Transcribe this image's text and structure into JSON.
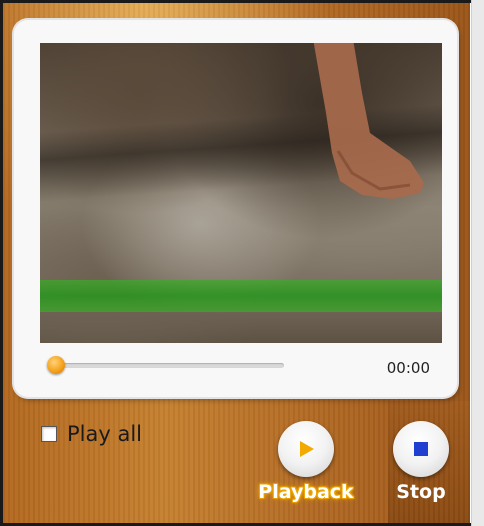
{
  "player": {
    "time_display": "00:00",
    "seek_position": 0
  },
  "options": {
    "play_all_label": "Play all",
    "play_all_checked": false
  },
  "controls": {
    "playback_label": "Playback",
    "stop_label": "Stop",
    "play_icon": "play-triangle-icon",
    "stop_icon": "stop-square-icon"
  },
  "colors": {
    "accent": "#f5a21b",
    "play_icon": "#f2a900",
    "stop_icon": "#1f3fd0",
    "background": "#b8711f"
  }
}
